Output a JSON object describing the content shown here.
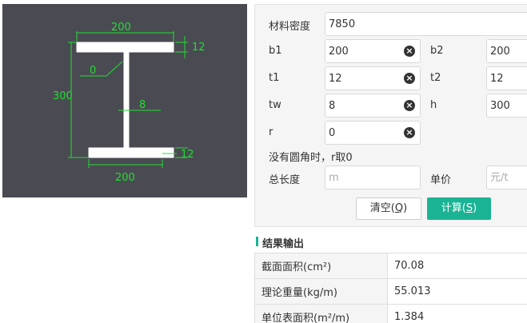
{
  "diagram": {
    "top_width": "200",
    "top_flange_thickness": "12",
    "height": "300",
    "radius": "0",
    "web_thickness": "8",
    "bottom_flange_thickness": "12",
    "bottom_width": "200",
    "bg_color": "#4a4b52",
    "dim_color": "#22dd33"
  },
  "form": {
    "density": {
      "label": "材料密度",
      "value": "7850"
    },
    "b1": {
      "label": "b1",
      "value": "200"
    },
    "b2": {
      "label": "b2",
      "value": "200"
    },
    "t1": {
      "label": "t1",
      "value": "12"
    },
    "t2": {
      "label": "t2",
      "value": "12"
    },
    "tw": {
      "label": "tw",
      "value": "8"
    },
    "h": {
      "label": "h",
      "value": "300"
    },
    "r": {
      "label": "r",
      "value": "0"
    },
    "hint": "没有圆角时，r取0",
    "length": {
      "label": "总长度",
      "placeholder": "m"
    },
    "price": {
      "label": "单价",
      "placeholder": "元/t"
    },
    "clear_icon": "×"
  },
  "buttons": {
    "clear": {
      "text": "清空(",
      "key": "Q",
      "close": ")"
    },
    "calc": {
      "text": "计算(",
      "key": "S",
      "close": ")"
    },
    "accent": "#1ab394"
  },
  "results": {
    "title": "结果输出",
    "rows": [
      {
        "key": "截面面积(cm²)",
        "value": "70.08"
      },
      {
        "key": "理论重量(kg/m)",
        "value": "55.013"
      },
      {
        "key": "单位表面积(m²/m)",
        "value": "1.384"
      }
    ]
  }
}
